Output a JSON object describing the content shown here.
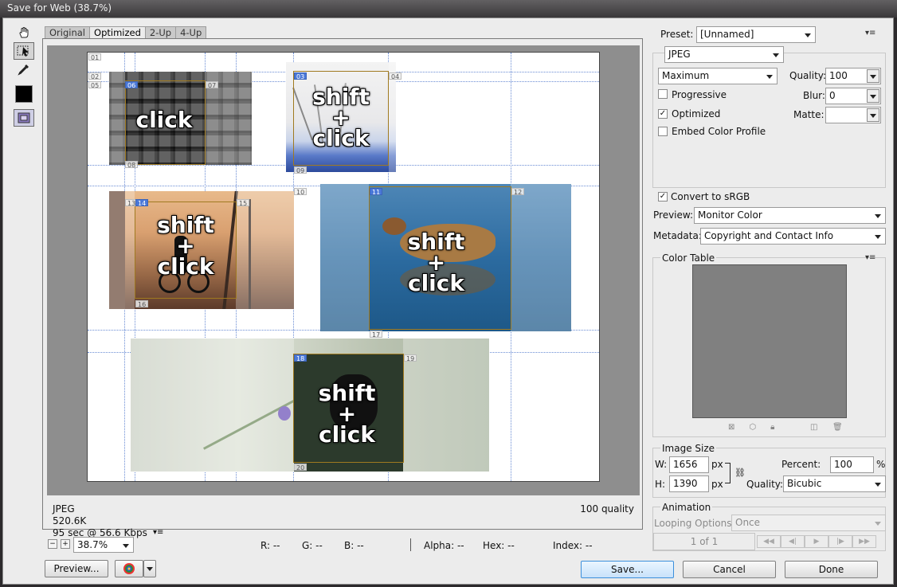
{
  "window": {
    "title": "Save for Web (38.7%)"
  },
  "tabs": [
    {
      "label": "Original",
      "active": false
    },
    {
      "label": "Optimized",
      "active": true
    },
    {
      "label": "2-Up",
      "active": false
    },
    {
      "label": "4-Up",
      "active": false
    }
  ],
  "tools": [
    {
      "icon": "hand-tool-icon",
      "selected": false
    },
    {
      "icon": "slice-select-tool-icon",
      "selected": true
    },
    {
      "icon": "zoom-tool-icon",
      "selected": false
    },
    {
      "icon": "eyedropper-tool-icon",
      "selected": false
    }
  ],
  "canvas": {
    "click_labels": {
      "cubes": "click",
      "flower": [
        "shift",
        "+",
        "click"
      ],
      "bike": [
        "shift",
        "+",
        "click"
      ],
      "duck": [
        "shift",
        "+",
        "click"
      ],
      "butterfly": [
        "shift",
        "+",
        "click"
      ]
    },
    "slices": [
      "01",
      "02",
      "03",
      "04",
      "05",
      "06",
      "07",
      "08",
      "09",
      "10",
      "11",
      "12",
      "13",
      "14",
      "15",
      "16",
      "17",
      "18",
      "19",
      "20"
    ]
  },
  "preview_info": {
    "format": "JPEG",
    "size": "520.6K",
    "time": "95 sec @ 56.6 Kbps",
    "quality": "100 quality"
  },
  "status_bar": {
    "zoom": "38.7%",
    "r": "R: --",
    "g": "G: --",
    "b": "B: --",
    "alpha": "Alpha: --",
    "hex": "Hex: --",
    "index": "Index: --"
  },
  "buttons": {
    "preview": "Preview...",
    "save": "Save...",
    "cancel": "Cancel",
    "done": "Done"
  },
  "settings": {
    "preset_label": "Preset:",
    "preset_value": "[Unnamed]",
    "format": "JPEG",
    "compression": "Maximum",
    "quality_label": "Quality:",
    "quality_value": "100",
    "blur_label": "Blur:",
    "blur_value": "0",
    "matte_label": "Matte:",
    "progressive_label": "Progressive",
    "progressive_checked": false,
    "optimized_label": "Optimized",
    "optimized_checked": true,
    "embed_label": "Embed Color Profile",
    "embed_checked": false,
    "srgb_label": "Convert to sRGB",
    "srgb_checked": true,
    "preview_label": "Preview:",
    "preview_value": "Monitor Color",
    "metadata_label": "Metadata:",
    "metadata_value": "Copyright and Contact Info"
  },
  "color_table": {
    "title": "Color Table",
    "fill": "#808080"
  },
  "image_size": {
    "title": "Image Size",
    "w_label": "W:",
    "w_value": "1656",
    "h_label": "H:",
    "h_value": "1390",
    "unit": "px",
    "percent_label": "Percent:",
    "percent_value": "100",
    "percent_unit": "%",
    "quality_label": "Quality:",
    "quality_value": "Bicubic"
  },
  "animation": {
    "title": "Animation",
    "looping_label": "Looping Options:",
    "looping_value": "Once",
    "frame_counter": "1 of 1"
  }
}
